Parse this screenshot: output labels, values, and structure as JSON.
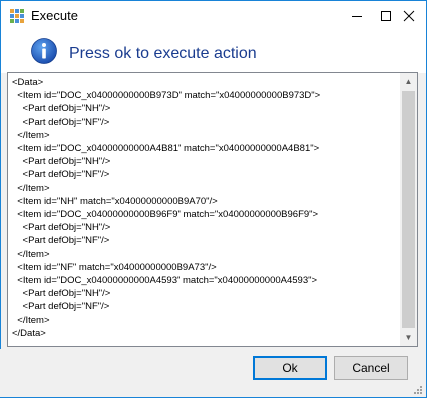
{
  "window": {
    "title": "Execute",
    "app_icon": "app-grid-icon",
    "controls": {
      "minimize": "minimize-icon",
      "maximize": "maximize-icon",
      "close": "close-icon"
    }
  },
  "header": {
    "icon": "info-icon",
    "message": "Press ok to execute action"
  },
  "content": {
    "lines": [
      "<Data>",
      "  <Item id=\"DOC_x04000000000B973D\" match=\"x04000000000B973D\">",
      "    <Part defObj=\"NH\"/>",
      "    <Part defObj=\"NF\"/>",
      "  </Item>",
      "  <Item id=\"DOC_x04000000000A4B81\" match=\"x04000000000A4B81\">",
      "    <Part defObj=\"NH\"/>",
      "    <Part defObj=\"NF\"/>",
      "  </Item>",
      "  <Item id=\"NH\" match=\"x04000000000B9A70\"/>",
      "  <Item id=\"DOC_x04000000000B96F9\" match=\"x04000000000B96F9\">",
      "    <Part defObj=\"NH\"/>",
      "    <Part defObj=\"NF\"/>",
      "  </Item>",
      "  <Item id=\"NF\" match=\"x04000000000B9A73\"/>",
      "  <Item id=\"DOC_x04000000000A4593\" match=\"x04000000000A4593\">",
      "    <Part defObj=\"NH\"/>",
      "    <Part defObj=\"NF\"/>",
      "  </Item>",
      "</Data>"
    ]
  },
  "buttons": {
    "ok": "Ok",
    "cancel": "Cancel"
  },
  "colors": {
    "accent": "#1883d7",
    "header_text": "#1a3c8f"
  }
}
